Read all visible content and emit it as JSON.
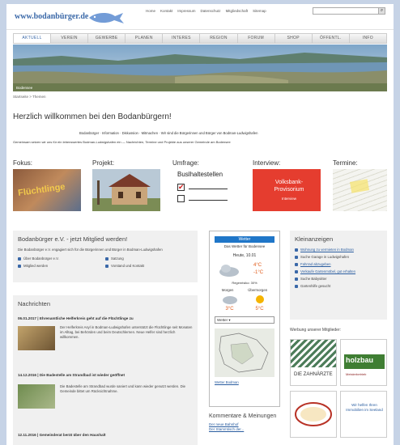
{
  "site": {
    "logo": "www.bodanbürger.de"
  },
  "toplinks": [
    "Home",
    "Kontakt",
    "Impressum",
    "Datenschutz",
    "Mitgliedschaft",
    "Sitemap"
  ],
  "nav": [
    "AKTUELL",
    "VEREIN",
    "GEWERBE",
    "PLANEN",
    "INTERES",
    "REGION",
    "FORUM",
    "SHOP",
    "ÖFFENTL.",
    "INFO"
  ],
  "banner_caption": "Bodensee",
  "breadcrumb": "Startseite > Themen",
  "welcome": "Herzlich willkommen bei den Bodanbürgern!",
  "sub1": "Bodanbürger · Information · Diskussion · Mitmachen · Wir sind die Bürgerinnen und Bürger von Bodman-Ludwigshafen",
  "sub2": "Gemeinsam setzen wir uns für ein lebenswertes Bodman-Ludwigshafen ein — Nachrichten, Termine und Projekte aus unserer Gemeinde am Bodensee",
  "tiles": [
    {
      "title": "Fokus:",
      "img_text": "Flüchtlinge"
    },
    {
      "title": "Projekt:",
      "img_text": ""
    },
    {
      "title": "Umfrage:",
      "img_text": "Buslhaltestellen"
    },
    {
      "title": "Interview:",
      "img_text": "Volksbank-Provisorium",
      "img_sub": "Interview"
    },
    {
      "title": "Termine:",
      "img_text": ""
    }
  ],
  "member": {
    "title": "Bodanbürger e.V. - jetzt Mitglied werden!",
    "intro": "Die Bodanbürger e.V. engagiert sich für die Bürgerinnen und Bürger in Bodman-Ludwigshafen",
    "links": [
      "Über Bodanbürger e.V.",
      "Satzung",
      "Mitglied werden",
      "Vorstand und Kontakt"
    ]
  },
  "news": {
    "title": "Nachrichten",
    "items": [
      {
        "head": "06.01.2017 | Ehrenamtliche Helferkreis geht auf die Flüchtlinge zu",
        "text": "Der Helferkreis Asyl in Bodman-Ludwigshafen unterstützt die Flüchtlinge seit Monaten im Alltag, bei Behörden und beim Deutschlernen. Neue Helfer sind herzlich willkommen."
      },
      {
        "head": "14.12.2016 | Die Badestelle am Strandbad ist wieder geöffnet",
        "text": "Die Badestelle am Strandbad wurde saniert und kann wieder genutzt werden. Die Gemeinde bittet um Rücksichtnahme."
      },
      {
        "head": "12.11.2016 | Gemeinderat berät über den Haushalt",
        "text": ""
      }
    ]
  },
  "weather": {
    "header": "Wetter",
    "location": "Das Wetter für Bodensee",
    "date": "Heute, 10.01",
    "temp_high": "4°C",
    "temp_low": "-1°C",
    "precip": "Regenrisiko: 30%",
    "days": [
      "Morgen",
      "Übermorgen"
    ],
    "day_temps": [
      "3°C",
      "5°C"
    ],
    "select_label": "Wetter ▾",
    "footer": "Wetter Bodman"
  },
  "classifieds": {
    "title": "Kleinanzeigen",
    "items": [
      "Wohnung zu vermieten in Bodman",
      "Suche Garage in Ludwigshafen",
      "Fahrrad abzugeben",
      "Verkaufe Gartenmöbel, gut erhalten",
      "Suche Babysitter",
      "Gartenhilfe gesucht"
    ]
  },
  "sponsors": {
    "title": "Werbung unserer Mitglieder:",
    "items": [
      {
        "name": "DIE ZAHNÄRZTE",
        "text": ""
      },
      {
        "name": "holzbau",
        "text": "Meisterbetrieb"
      },
      {
        "name": "",
        "text": ""
      },
      {
        "name": "",
        "text": "Wir helfen Ihren Immobilien im Seeland"
      }
    ]
  },
  "comments": {
    "title": "Kommentare & Meinungen",
    "items": [
      "Der neue Bahnhof",
      "Der Stammtisch der..."
    ]
  }
}
